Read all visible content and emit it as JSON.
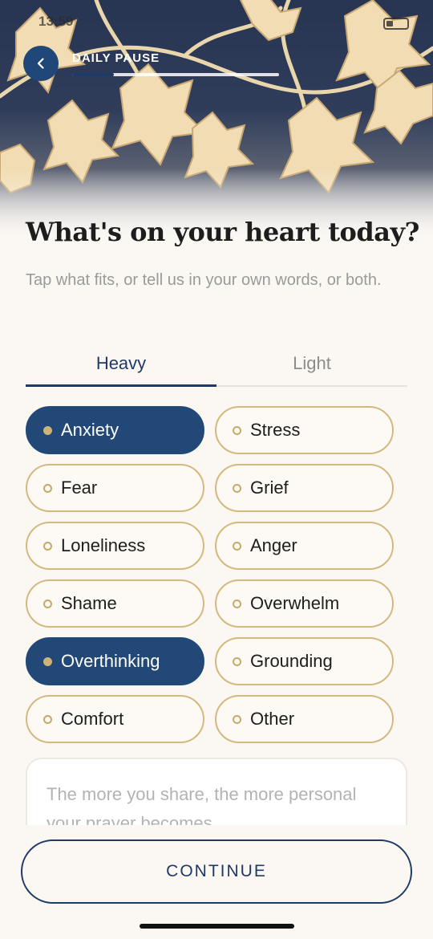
{
  "status_bar": {
    "time": "13:59"
  },
  "header": {
    "label": "DAILY PAUSE",
    "progress_fraction": 0.2
  },
  "main": {
    "title": "What's on your heart today?",
    "subtitle": "Tap what fits, or tell us in your own words, or both."
  },
  "tabs": [
    {
      "label": "Heavy",
      "active": true
    },
    {
      "label": "Light",
      "active": false
    }
  ],
  "chips": [
    {
      "label": "Anxiety",
      "selected": true
    },
    {
      "label": "Stress",
      "selected": false
    },
    {
      "label": "Fear",
      "selected": false
    },
    {
      "label": "Grief",
      "selected": false
    },
    {
      "label": "Loneliness",
      "selected": false
    },
    {
      "label": "Anger",
      "selected": false
    },
    {
      "label": "Shame",
      "selected": false
    },
    {
      "label": "Overwhelm",
      "selected": false
    },
    {
      "label": "Overthinking",
      "selected": true
    },
    {
      "label": "Grounding",
      "selected": false
    },
    {
      "label": "Comfort",
      "selected": false
    },
    {
      "label": "Other",
      "selected": false
    }
  ],
  "textbox": {
    "placeholder": "The more you share, the more personal your prayer becomes",
    "value": ""
  },
  "footer": {
    "continue_label": "CONTINUE"
  },
  "colors": {
    "accent": "#1f3a66",
    "selected_chip": "#224878",
    "chip_border": "#d5b87e"
  }
}
